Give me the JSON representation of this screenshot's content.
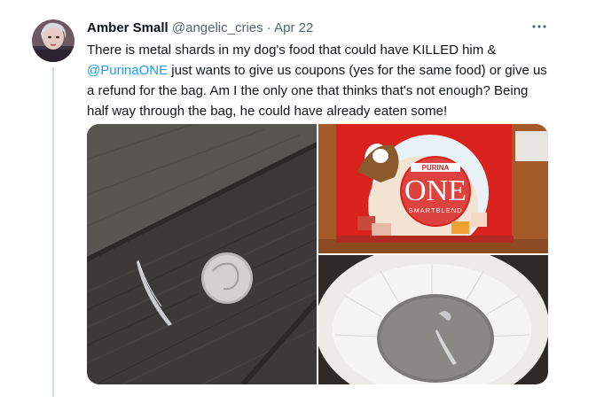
{
  "tweet": {
    "author_name": "Amber Small",
    "handle": "@angelic_cries",
    "separator": "·",
    "date": "Apr 22",
    "more_icon": "more-horizontal-icon",
    "text_part1": "There is metal shards in my dog's food that could have KILLED him &",
    "mention": "@PurinaONE",
    "text_part2": " just wants to give us coupons (yes for the same food) or give us a refund for the bag. Am I the only one that thinks that's not enough? Being half way through the bag, he could have already eaten some!"
  },
  "media": {
    "bag": {
      "brand": "PURINA",
      "product": "ONE",
      "line": "SMARTBLEND"
    }
  },
  "colors": {
    "text": "#0f1419",
    "secondary": "#536471",
    "link": "#1d9bf0",
    "thread": "#cfd9de",
    "bag_red": "#d9211d"
  }
}
